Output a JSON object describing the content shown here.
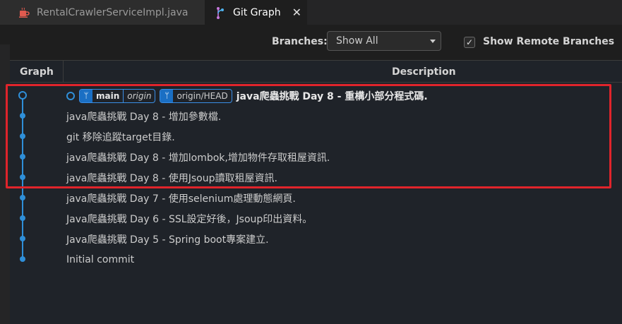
{
  "tabs": [
    {
      "label": "RentalCrawlerServiceImpl.java",
      "icon": "java-coffee-icon",
      "active": false
    },
    {
      "label": "Git Graph",
      "icon": "git-graph-icon",
      "active": true,
      "close": "✕"
    }
  ],
  "controls": {
    "branches_label": "Branches:",
    "branches_value": "Show All",
    "show_remote_label": "Show Remote Branches",
    "show_remote_checked": true
  },
  "table": {
    "col_graph": "Graph",
    "col_description": "Description"
  },
  "commits": [
    {
      "refs": [
        {
          "name": "main",
          "remote": "origin"
        },
        {
          "name": "origin/HEAD"
        }
      ],
      "message": "java爬蟲挑戰 Day 8 - 重構小部分程式碼.",
      "head": true
    },
    {
      "message": "java爬蟲挑戰 Day 8 - 增加參數檔."
    },
    {
      "message": "git 移除追蹤target目錄."
    },
    {
      "message": "java爬蟲挑戰 Day 8 - 增加lombok,增加物件存取租屋資訊."
    },
    {
      "message": "java爬蟲挑戰 Day 8 - 使用Jsoup讀取租屋資訊."
    },
    {
      "message": "java爬蟲挑戰 Day 7 - 使用selenium處理動態網頁."
    },
    {
      "message": "Java爬蟲挑戰 Day 6 - SSL設定好後，Jsoup印出資料。"
    },
    {
      "message": "Java爬蟲挑戰 Day 5 - Spring boot專案建立."
    },
    {
      "message": "Initial commit"
    }
  ],
  "colors": {
    "graph_line": "#2f8fd8",
    "highlight": "#e0242b",
    "ref_badge": "#1a6fc4"
  }
}
